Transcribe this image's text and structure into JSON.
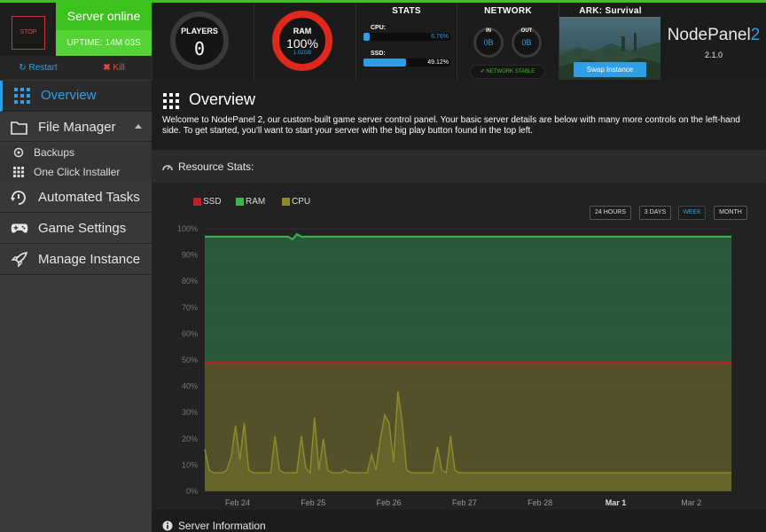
{
  "server": {
    "stop_label": "STOP",
    "status": "Server online",
    "uptime": "UPTIME: 14M 03S",
    "restart_label": "Restart",
    "kill_label": "Kill"
  },
  "players": {
    "title": "PLAYERS",
    "count": "0"
  },
  "ram": {
    "title": "RAM",
    "percent": "100%",
    "amount": "1.02GB"
  },
  "stats": {
    "title": "STATS",
    "cpu_label": "CPU:",
    "cpu_value": "6.76%",
    "cpu_fraction": 0.0676,
    "ssd_label": "SSD:",
    "ssd_value": "49.12%",
    "ssd_fraction": 0.4912
  },
  "network": {
    "title": "NETWORK",
    "in_label": "IN",
    "in_value": "0B",
    "out_label": "OUT",
    "out_value": "0B",
    "status": "NETWORK STABLE"
  },
  "game": {
    "title": "ARK: Survival",
    "swap_label": "Swap Instance"
  },
  "brand": {
    "name": "NodePanel",
    "name_suffix": "2",
    "version": "2.1.0"
  },
  "sidebar": {
    "items": [
      {
        "label": "Overview"
      },
      {
        "label": "File Manager"
      },
      {
        "label": "Backups"
      },
      {
        "label": "One Click Installer"
      },
      {
        "label": "Automated Tasks"
      },
      {
        "label": "Game Settings"
      },
      {
        "label": "Manage Instance"
      }
    ]
  },
  "main": {
    "title": "Overview",
    "welcome": "Welcome to NodePanel 2, our custom-built game server control panel. Your basic server details are below with many more controls on the left-hand side. To get started, you'll want to start your server with the big play button found in the top left.",
    "resource_title": "Resource Stats:",
    "server_info_title": "Server Information"
  },
  "range_buttons": [
    "24 HOURS",
    "3 DAYS",
    "WEEK",
    "MONTH"
  ],
  "active_range": "WEEK",
  "colors": {
    "accent": "#2e9fe6",
    "online": "#3bc21c",
    "danger": "#e0291c",
    "ram": "#3bb54a",
    "cpu": "#8d8a2c",
    "ssd": "#b8222a"
  },
  "chart_data": {
    "type": "area",
    "legend": [
      "SSD",
      "RAM",
      "CPU"
    ],
    "x_ticks": [
      "Feb 24",
      "Feb 25",
      "Feb 26",
      "Feb 27",
      "Feb 28",
      "Mar 1",
      "Mar 2"
    ],
    "y_ticks": [
      "0%",
      "10%",
      "20%",
      "30%",
      "40%",
      "50%",
      "60%",
      "70%",
      "80%",
      "90%",
      "100%"
    ],
    "ylim": [
      0,
      100
    ],
    "series": [
      {
        "name": "SSD",
        "values": [
          49,
          49,
          49,
          49,
          49,
          49,
          49,
          49,
          49,
          49,
          49,
          49,
          49,
          49,
          49,
          49,
          49,
          49,
          49,
          49,
          49,
          49,
          49,
          49,
          49,
          49,
          49,
          49,
          49,
          49,
          49,
          49,
          49,
          49,
          49,
          49,
          49,
          49,
          49,
          49,
          49,
          49,
          49,
          49,
          49,
          49,
          49,
          49,
          49,
          49,
          49,
          49,
          49,
          49,
          49,
          49,
          49,
          49,
          49,
          49,
          49,
          49,
          49,
          49,
          49,
          49,
          49,
          49,
          49,
          49,
          49,
          49,
          49,
          49,
          49,
          49,
          49,
          49,
          49,
          49,
          49,
          49,
          49,
          49,
          49,
          49,
          49,
          49,
          49,
          49,
          49,
          49,
          49,
          49,
          49,
          49,
          49,
          49,
          49,
          49,
          49,
          49,
          49,
          49,
          49,
          49,
          49,
          49,
          49,
          49,
          49,
          49,
          49,
          49,
          49,
          49,
          49,
          49,
          49,
          49,
          49
        ]
      },
      {
        "name": "RAM",
        "values": [
          97,
          97,
          97,
          97,
          97,
          97,
          97,
          97,
          97,
          97,
          97,
          97,
          97,
          97,
          97,
          97,
          97,
          97,
          97,
          97,
          96,
          98,
          97,
          97,
          97,
          97,
          97,
          97,
          97,
          97,
          97,
          97,
          97,
          97,
          97,
          97,
          97,
          97,
          97,
          97,
          97,
          97,
          97,
          97,
          97,
          97,
          97,
          97,
          97,
          97,
          97,
          97,
          97,
          97,
          97,
          97,
          97,
          97,
          97,
          97,
          97,
          97,
          97,
          97,
          97,
          97,
          97,
          97,
          97,
          97,
          97,
          97,
          97,
          97,
          97,
          97,
          97,
          97,
          97,
          97,
          97,
          97,
          97,
          97,
          97,
          97,
          97,
          97,
          97,
          97,
          97,
          97,
          97,
          97,
          97,
          97,
          97,
          97,
          97,
          97,
          97,
          97,
          97,
          97,
          97,
          97,
          97,
          97,
          97,
          97,
          97,
          97,
          97,
          97,
          97,
          97,
          97,
          97,
          97,
          97,
          97
        ]
      },
      {
        "name": "CPU",
        "values": [
          16,
          8,
          7,
          7,
          7,
          8,
          13,
          25,
          12,
          26,
          8,
          7,
          7,
          7,
          7,
          7,
          21,
          8,
          7,
          7,
          7,
          7,
          21,
          9,
          7,
          28,
          8,
          20,
          8,
          7,
          7,
          7,
          8,
          7,
          7,
          7,
          7,
          7,
          14,
          8,
          20,
          29,
          26,
          11,
          38,
          26,
          8,
          7,
          7,
          7,
          7,
          7,
          7,
          17,
          8,
          7,
          21,
          8,
          7,
          7,
          7,
          7,
          7,
          7,
          7,
          7,
          7,
          7,
          7,
          7,
          7,
          7,
          7,
          7,
          7,
          7,
          7,
          7,
          7,
          7,
          7,
          7,
          7,
          7,
          7,
          7,
          7,
          7,
          7,
          7,
          7,
          7,
          7,
          7,
          7,
          7,
          7,
          7,
          7,
          7,
          7,
          7,
          7,
          7,
          7,
          7,
          7,
          7,
          7,
          7,
          7,
          7,
          7,
          7,
          7,
          7,
          7,
          7,
          7,
          7,
          7
        ]
      }
    ]
  }
}
